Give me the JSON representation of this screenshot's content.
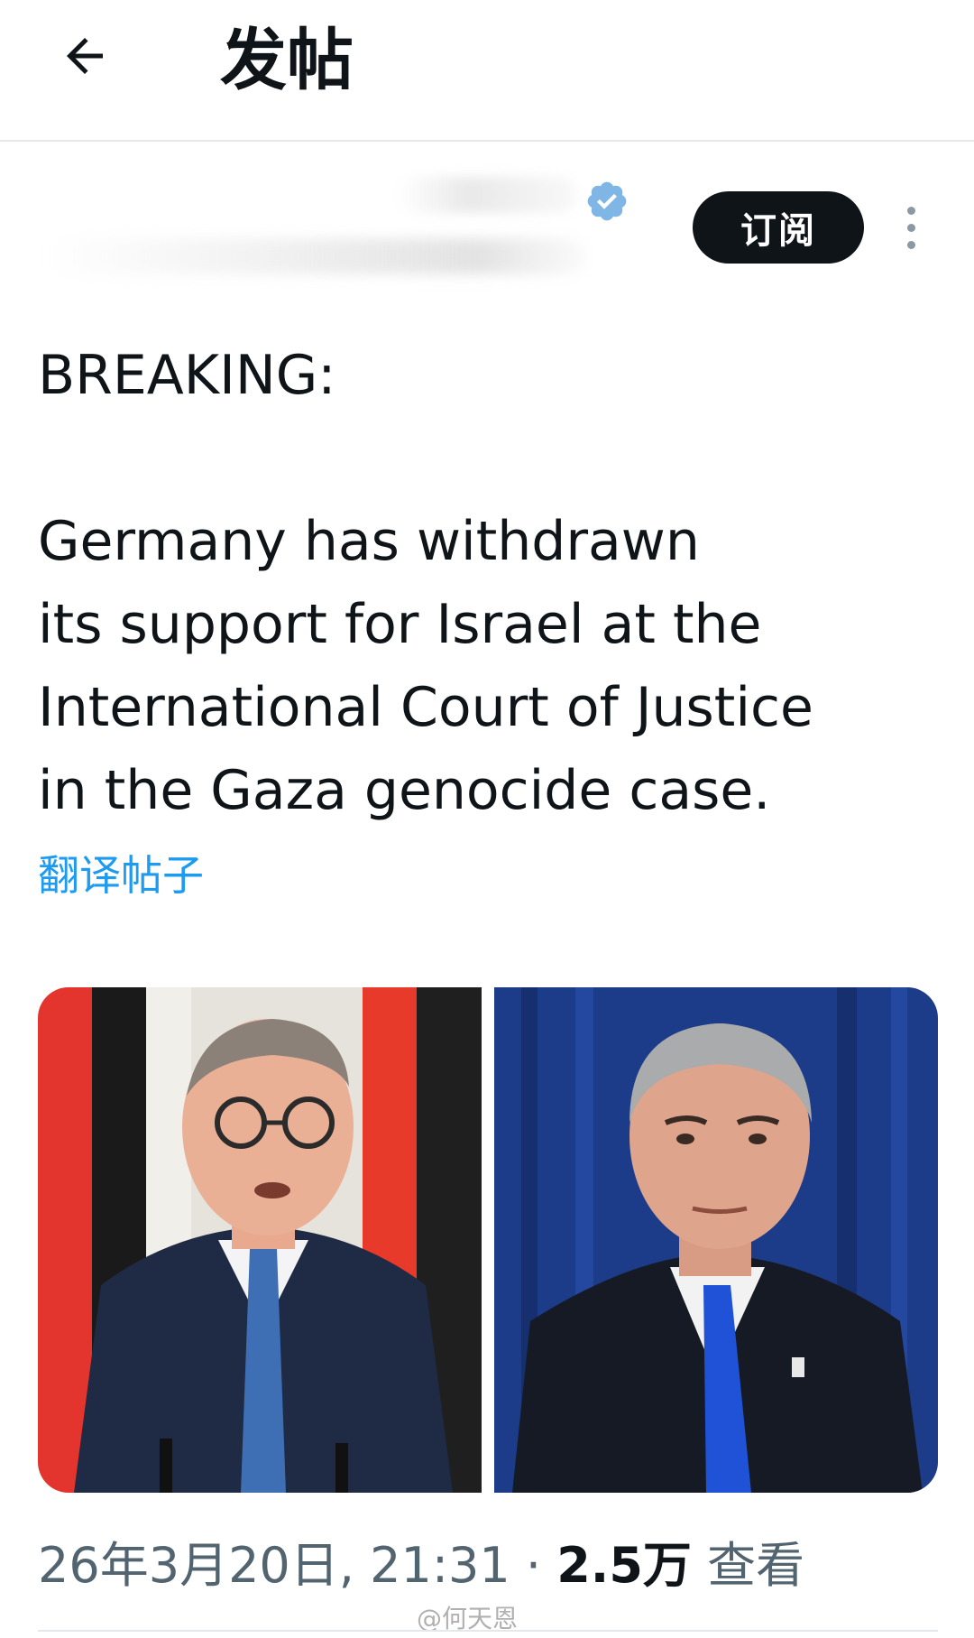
{
  "header": {
    "title": "发帖"
  },
  "author": {
    "subscribe_label": "订阅"
  },
  "post": {
    "lines_1": [
      "BREAKING:"
    ],
    "lines_2": [
      "Germany has withdrawn",
      "its support for Israel at the",
      "International Court of Justice",
      "in the Gaza genocide case."
    ],
    "translate_label": "翻译帖子"
  },
  "meta": {
    "timestamp": "26年3月20日, 21:31",
    "separator": " · ",
    "views_count": "2.5万",
    "views_label": " 查看"
  },
  "watermark": "@何天恩",
  "colors": {
    "accent": "#1d9bf0",
    "text": "#0f1419",
    "muted": "#536471",
    "button_bg": "#0f1419"
  },
  "icons": {
    "back": "arrow-left-icon",
    "verified": "verified-badge-icon",
    "more": "more-vertical-icon"
  }
}
